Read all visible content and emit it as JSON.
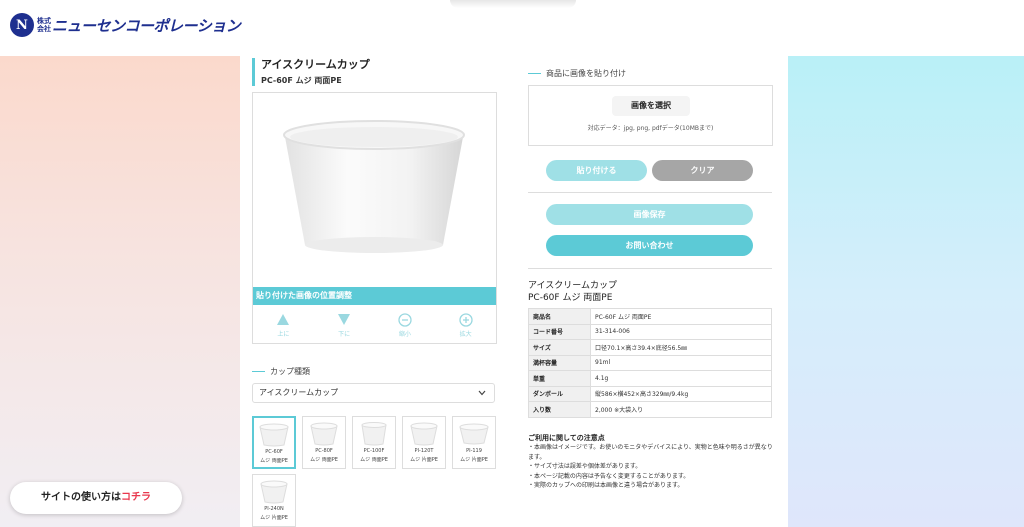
{
  "header": {
    "logo_mark": "N",
    "logo_small": "株式会社",
    "company_name": "ニューセンコーポレーション"
  },
  "product": {
    "title": "アイスクリームカップ",
    "subtitle": "PC-60F ムジ 両面PE"
  },
  "position_adjust": {
    "label": "貼り付けた画像の位置調整",
    "controls": [
      {
        "label": "上に",
        "icon": "triangle-up-icon"
      },
      {
        "label": "下に",
        "icon": "triangle-down-icon"
      },
      {
        "label": "縮小",
        "icon": "zoom-out-icon"
      },
      {
        "label": "拡大",
        "icon": "zoom-in-icon"
      }
    ]
  },
  "cup_type": {
    "label": "カップ種類",
    "selected": "アイスクリームカップ"
  },
  "thumbnails": [
    {
      "code": "PC-60F",
      "desc": "ムジ 両面PE",
      "selected": true
    },
    {
      "code": "PC-80F",
      "desc": "ムジ 両面PE",
      "selected": false
    },
    {
      "code": "PC-100F",
      "desc": "ムジ 両面PE",
      "selected": false
    },
    {
      "code": "PI-120T",
      "desc": "ムジ 片面PE",
      "selected": false
    },
    {
      "code": "PI-119",
      "desc": "ムジ 片面PE",
      "selected": false
    },
    {
      "code": "PI-240N",
      "desc": "ムジ 片面PE",
      "selected": false
    }
  ],
  "upload": {
    "heading": "商品に画像を貼り付け",
    "select_button": "画像を選択",
    "note": "対応データ：jpg, png, pdfデータ(10MBまで)"
  },
  "buttons": {
    "paste": "貼り付ける",
    "clear": "クリア",
    "save_image": "画像保存",
    "contact": "お問い合わせ"
  },
  "info": {
    "title": "アイスクリームカップ",
    "subtitle": "PC-60F ムジ 両面PE",
    "specs": [
      {
        "key": "商品名",
        "value": "PC-60F ムジ 両面PE"
      },
      {
        "key": "コード番号",
        "value": "31-314-006"
      },
      {
        "key": "サイズ",
        "value": "口径70.1×高さ39.4×底径56.5㎜"
      },
      {
        "key": "満杯容量",
        "value": "91ml"
      },
      {
        "key": "単重",
        "value": "4.1g"
      },
      {
        "key": "ダンボール",
        "value": "縦586×横452×高さ329㎜/9.4kg"
      },
      {
        "key": "入り数",
        "value": "2,000 ※大袋入り"
      }
    ]
  },
  "notes": {
    "title": "ご利用に関しての注意点",
    "items": [
      "・本画像はイメージです。お使いのモニタやデバイスにより、実物と色味や明るさが異なります。",
      "・サイズ寸法は誤差や個体差があります。",
      "・本ページ記載の内容は予告なく変更することがあります。",
      "・実際のカップへの印刷は本画像と違う場合があります。"
    ]
  },
  "help": {
    "prefix": "サイトの使い方は",
    "highlight": "コチラ"
  },
  "colors": {
    "accent": "#5ccad6",
    "accent_light": "#9fe0e6",
    "gray_button": "#a6a6a6",
    "brand_navy": "#1e2f8f",
    "highlight_red": "#e8374d"
  }
}
